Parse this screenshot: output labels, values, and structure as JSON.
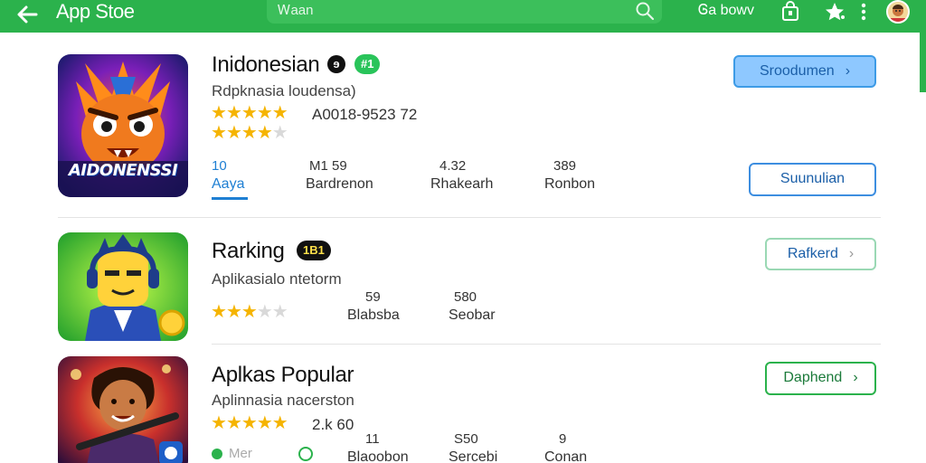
{
  "topbar": {
    "title": "App Stoe",
    "search_placeholder": "Ꮃaan",
    "action_label": "Ꮆa bowv",
    "back_icon": "arrow-left-icon",
    "bag_icon": "shopping-bag-icon",
    "star_icon": "star-icon",
    "more_icon": "more-vert-icon",
    "accent_color": "#2bb24c"
  },
  "items": [
    {
      "title": "Inidonesian",
      "badge": "#1",
      "subtitle": "Rdpknasia loudensa)",
      "rating_text": "A0018-9523 72",
      "stars_row1": 5,
      "stars_row2": 4,
      "stars_total": 5,
      "icon_caption": "AIDONENSSI",
      "stats": [
        {
          "value": "10",
          "label": "Aaya"
        },
        {
          "value": "M1 59",
          "label": "Bardrenon"
        },
        {
          "value": "4.32",
          "label": "Rhakearh"
        },
        {
          "value": "389",
          "label": "Ronbon"
        }
      ],
      "button_primary": "Sroodumen",
      "button_secondary": "Suunulian"
    },
    {
      "title": "Rarking",
      "badge": "1B1",
      "subtitle": "Aplikasialo ntetorm",
      "stars": 3,
      "stars_total": 5,
      "stats": [
        {
          "value": "59",
          "label": "Blabsba"
        },
        {
          "value": "580",
          "label": "Seobar"
        }
      ],
      "button": "Rafkerd"
    },
    {
      "title": "Aplkas Popular",
      "subtitle": "Aplinnasia nacerston",
      "rating_text": "2.k 60",
      "stars": 5,
      "stars_total": 5,
      "small_label": "Mer",
      "stats": [
        {
          "value": "11",
          "label": "Blaoobon"
        },
        {
          "value": "S50",
          "label": "Sercebi"
        },
        {
          "value": "9",
          "label": "Conan"
        }
      ],
      "button": "Daphend"
    }
  ]
}
